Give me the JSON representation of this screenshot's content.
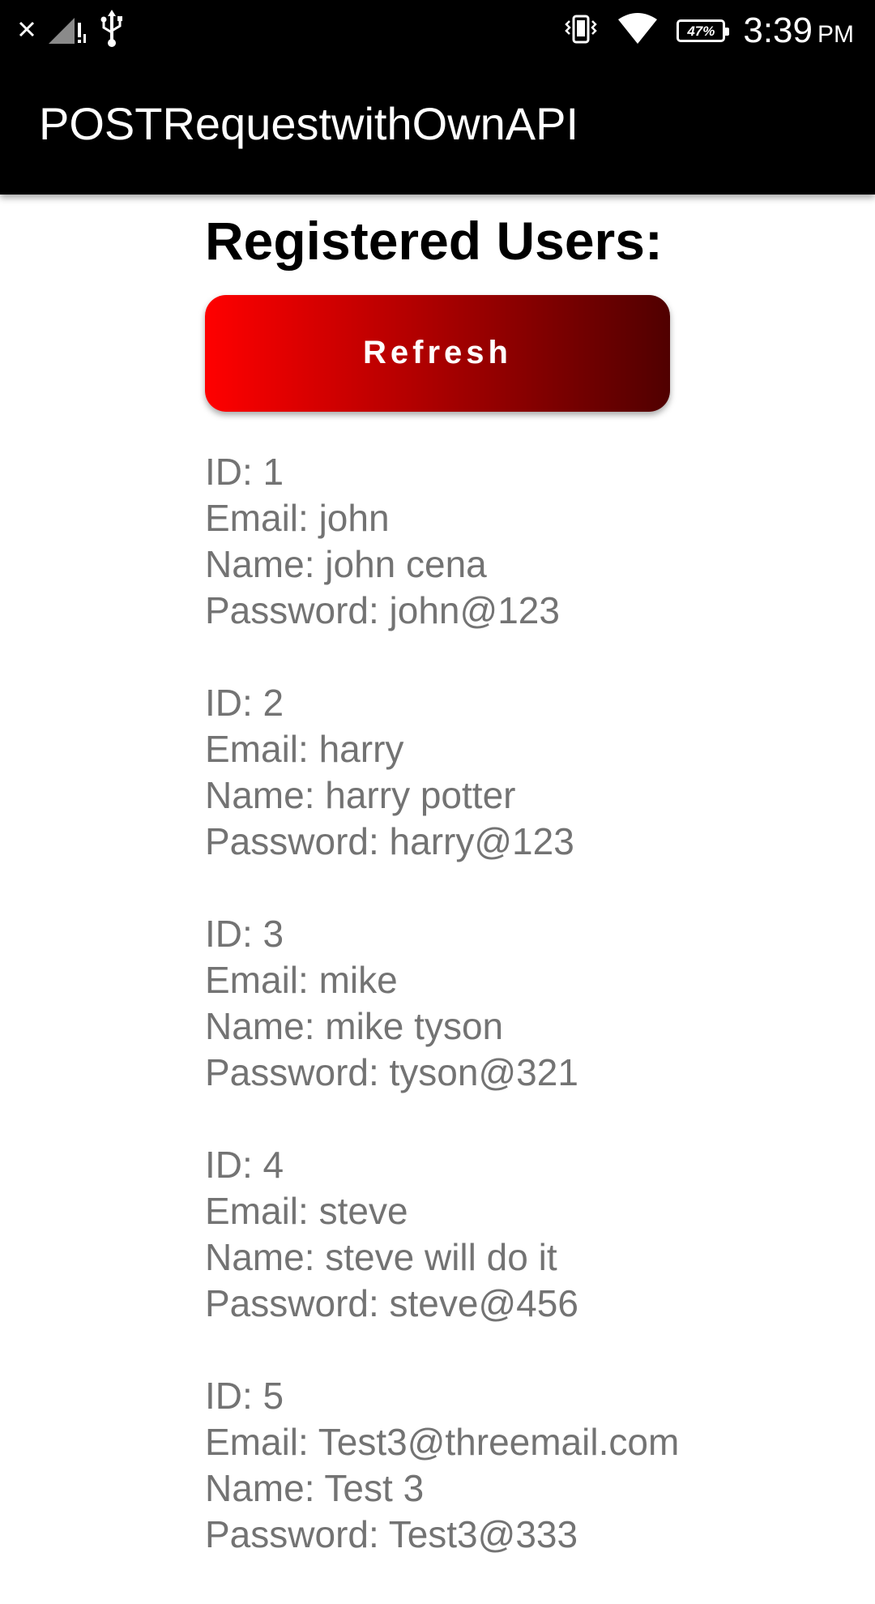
{
  "status_bar": {
    "time": "3:39",
    "ampm": "PM",
    "battery_percent": "47%",
    "colors": {
      "background": "#000000",
      "foreground": "#ffffff"
    },
    "icons": [
      "close-icon",
      "signal-icon",
      "usb-icon",
      "vibrate-icon",
      "wifi-icon",
      "battery-icon"
    ]
  },
  "app_bar": {
    "title": "POSTRequestwithOwnAPI",
    "background": "#000000"
  },
  "main": {
    "heading": "Registered Users:",
    "refresh_label": "Refresh",
    "button_gradient": [
      "#ff0000",
      "#500000"
    ],
    "users": [
      {
        "id": "ID: 1",
        "email": "Email: john",
        "name": "Name: john cena",
        "password": "Password: john@123"
      },
      {
        "id": "ID: 2",
        "email": "Email: harry",
        "name": "Name: harry potter",
        "password": "Password: harry@123"
      },
      {
        "id": "ID: 3",
        "email": "Email: mike",
        "name": "Name: mike tyson",
        "password": "Password: tyson@321"
      },
      {
        "id": "ID: 4",
        "email": "Email: steve",
        "name": "Name: steve will do it",
        "password": "Password: steve@456"
      },
      {
        "id": "ID: 5",
        "email": "Email: Test3@threemail.com",
        "name": "Name: Test 3",
        "password": "Password: Test3@333"
      }
    ]
  }
}
